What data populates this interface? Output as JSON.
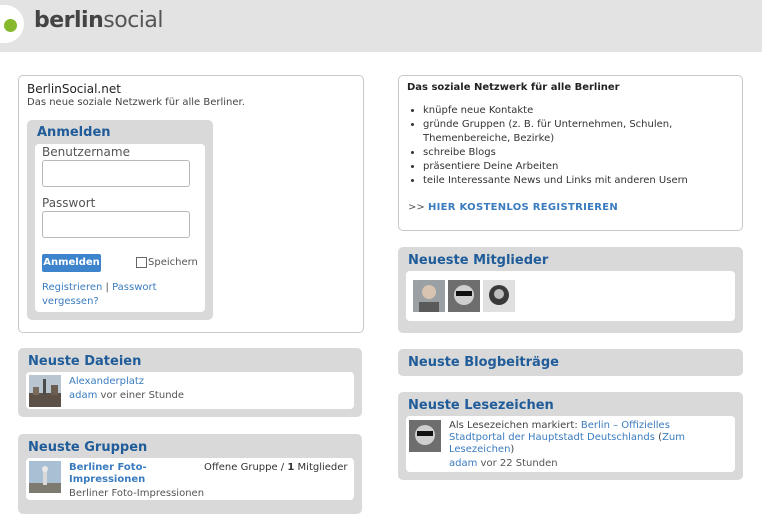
{
  "header": {
    "logo_bold": "berlin",
    "logo_light": "social"
  },
  "intro": {
    "title": "BerlinSocial.net",
    "subtitle": "Das neue soziale Netzwerk für alle Berliner."
  },
  "login": {
    "heading": "Anmelden",
    "username_label": "Benutzername",
    "password_label": "Passwort",
    "submit_label": "Anmelden",
    "remember_label": "Speichern",
    "register_link": "Registrieren",
    "separator": "|",
    "forgot_link": "Passwort vergessen?"
  },
  "features": {
    "title": "Das soziale Netzwerk für alle Berliner",
    "items": [
      "knüpfe neue Kontakte",
      "gründe Gruppen (z. B. für Unternehmen, Schulen, Themenbereiche, Bezirke)",
      "schreibe Blogs",
      "präsentiere Deine Arbeiten",
      "teile Interessante News und Links mit anderen Usern"
    ],
    "cta_prefix": ">>",
    "cta_label": "HIER KOSTENLOS REGISTRIEREN"
  },
  "files": {
    "heading": "Neuste Dateien",
    "item_title": "Alexanderplatz",
    "item_user": "adam",
    "item_time": "vor einer Stunde"
  },
  "groups": {
    "heading": "Neuste Gruppen",
    "item_title": "Berliner Foto-Impressionen",
    "item_type": "Offene Gruppe /",
    "item_count": "1",
    "item_members": "Mitglieder",
    "item_desc": "Berliner Foto-Impressionen"
  },
  "members": {
    "heading": "Neueste Mitglieder"
  },
  "blogs": {
    "heading": "Neuste Blogbeiträge"
  },
  "bookmarks": {
    "heading": "Neuste Lesezeichen",
    "prefix": "Als Lesezeichen markiert:",
    "link": "Berlin – Offizielles Stadtportal der Hauptstadt Deutschlands",
    "open_paren": "(",
    "zoom_link": "Zum Lesezeichen",
    "close_paren": ")",
    "user": "adam",
    "time": "vor 22 Stunden"
  },
  "colors": {
    "accent": "#1f5c99",
    "link": "#3a7bbf",
    "logo_dot": "#86b82c",
    "button": "#3d84cc"
  }
}
